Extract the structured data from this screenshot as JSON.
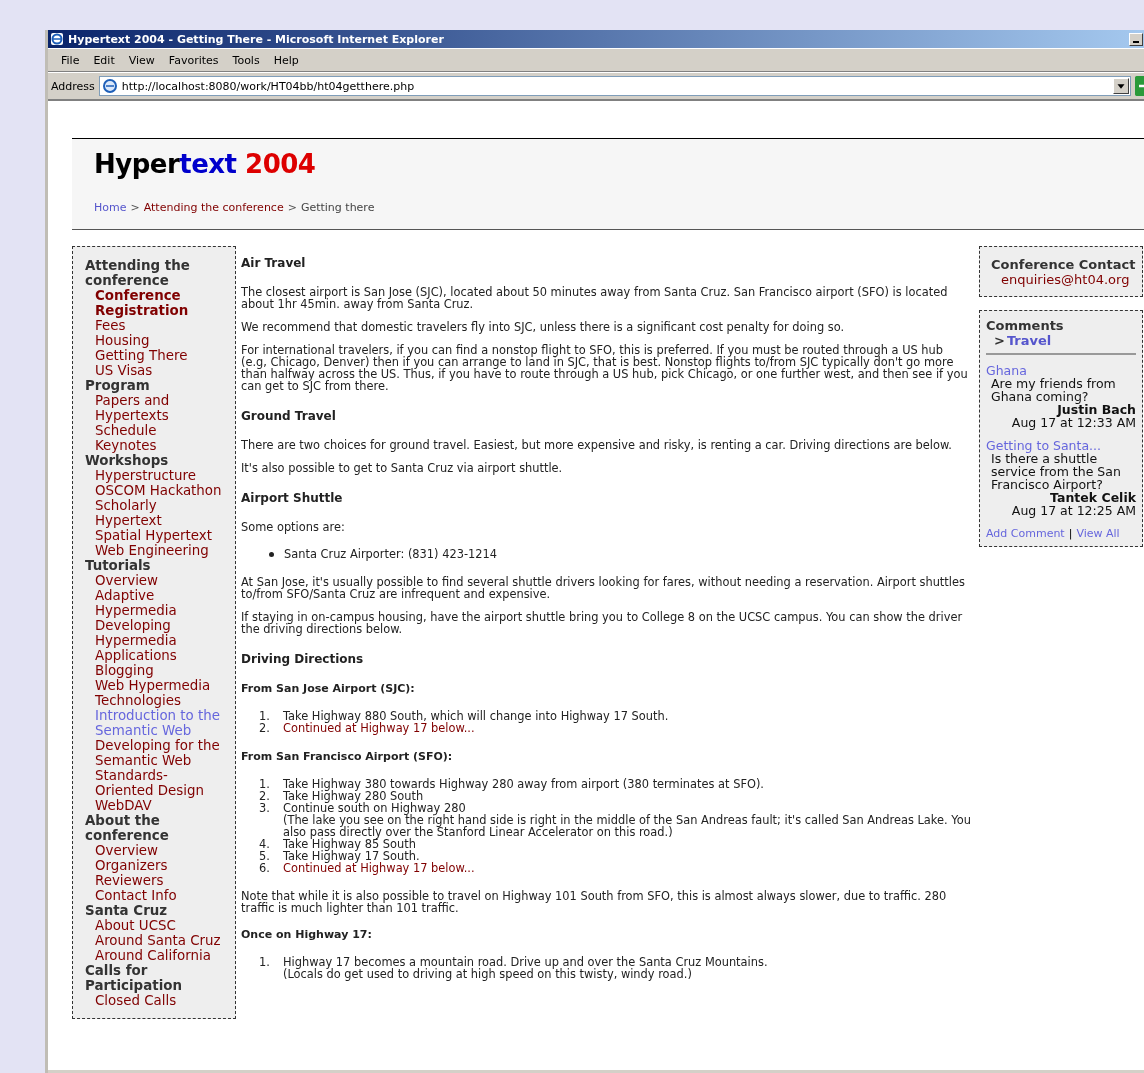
{
  "window": {
    "title": "Hypertext 2004 - Getting There - Microsoft Internet Explorer"
  },
  "menu": [
    "File",
    "Edit",
    "View",
    "Favorites",
    "Tools",
    "Help"
  ],
  "address": {
    "label": "Address",
    "url": "http://localhost:8080/work/HT04bb/ht04getthere.php"
  },
  "site_title": [
    {
      "text": "Hyper",
      "color": "#000000"
    },
    {
      "text": "text",
      "color": "#0000cc"
    },
    {
      "text": " 2004",
      "color": "#dd0000"
    }
  ],
  "breadcrumb": [
    {
      "text": "Home",
      "kind": "home"
    },
    {
      "text": ">",
      "kind": "sep"
    },
    {
      "text": "Attending the conference",
      "kind": "link"
    },
    {
      "text": ">",
      "kind": "sep"
    },
    {
      "text": "Getting there",
      "kind": "current"
    }
  ],
  "sidebar": [
    {
      "heading": "Attending the conference",
      "items": [
        {
          "text": "Conference Registration",
          "selected": true,
          "visited": false
        },
        {
          "text": "Fees",
          "selected": false,
          "visited": false
        },
        {
          "text": "Housing",
          "selected": false,
          "visited": false
        },
        {
          "text": "Getting There",
          "selected": false,
          "visited": false
        },
        {
          "text": "US Visas",
          "selected": false,
          "visited": false
        }
      ]
    },
    {
      "heading": "Program",
      "items": [
        {
          "text": "Papers and Hypertexts",
          "selected": false,
          "visited": false
        },
        {
          "text": "Schedule",
          "selected": false,
          "visited": false
        },
        {
          "text": "Keynotes",
          "selected": false,
          "visited": false
        }
      ]
    },
    {
      "heading": "Workshops",
      "items": [
        {
          "text": "Hyperstructure",
          "selected": false,
          "visited": false
        },
        {
          "text": "OSCOM Hackathon",
          "selected": false,
          "visited": false
        },
        {
          "text": "Scholarly Hypertext",
          "selected": false,
          "visited": false
        },
        {
          "text": "Spatial Hypertext",
          "selected": false,
          "visited": false
        },
        {
          "text": "Web Engineering",
          "selected": false,
          "visited": false
        }
      ]
    },
    {
      "heading": "Tutorials",
      "items": [
        {
          "text": "Overview",
          "selected": false,
          "visited": false
        },
        {
          "text": "Adaptive Hypermedia",
          "selected": false,
          "visited": false
        },
        {
          "text": "Developing Hypermedia Applications",
          "selected": false,
          "visited": false
        },
        {
          "text": "Blogging",
          "selected": false,
          "visited": false
        },
        {
          "text": "Web Hypermedia Technologies",
          "selected": false,
          "visited": false
        },
        {
          "text": "Introduction to the Semantic Web",
          "selected": false,
          "visited": true
        },
        {
          "text": "Developing for the Semantic Web",
          "selected": false,
          "visited": false
        },
        {
          "text": "Standards-Oriented Design",
          "selected": false,
          "visited": false
        },
        {
          "text": "WebDAV",
          "selected": false,
          "visited": false
        }
      ]
    },
    {
      "heading": "About the conference",
      "items": [
        {
          "text": "Overview",
          "selected": false,
          "visited": false
        },
        {
          "text": "Organizers",
          "selected": false,
          "visited": false
        },
        {
          "text": "Reviewers",
          "selected": false,
          "visited": false
        },
        {
          "text": "Contact Info",
          "selected": false,
          "visited": false
        }
      ]
    },
    {
      "heading": "Santa Cruz",
      "items": [
        {
          "text": "About UCSC",
          "selected": false,
          "visited": false
        },
        {
          "text": "Around Santa Cruz",
          "selected": false,
          "visited": false
        },
        {
          "text": "Around California",
          "selected": false,
          "visited": false
        }
      ]
    },
    {
      "heading": "Calls for Participation",
      "items": [
        {
          "text": "Closed Calls",
          "selected": false,
          "visited": false
        }
      ]
    }
  ],
  "article": [
    {
      "kind": "heading",
      "text": "Air Travel"
    },
    {
      "kind": "paragraph",
      "text": "The closest airport is San Jose (SJC), located about 50 minutes away from Santa Cruz. San Francisco airport (SFO) is located about 1hr 45min. away from Santa Cruz."
    },
    {
      "kind": "paragraph",
      "text": "We recommend that domestic travelers fly into SJC, unless there is a significant cost penalty for doing so."
    },
    {
      "kind": "paragraph",
      "text": "For international travelers, if you can find a nonstop flight to SFO, this is preferred. If you must be routed through a US hub (e.g, Chicago, Denver) then if you can arrange to land in SJC, that is best. Nonstop flights to/from SJC typically don't go more than halfway across the US. Thus, if you have to route through a US hub, pick Chicago, or one further west, and then see if you can get to SJC from there."
    },
    {
      "kind": "heading",
      "text": "Ground Travel"
    },
    {
      "kind": "paragraph",
      "text": "There are two choices for ground travel. Easiest, but more expensive and risky, is renting a car. Driving directions are below."
    },
    {
      "kind": "paragraph",
      "text": "It's also possible to get to Santa Cruz via airport shuttle."
    },
    {
      "kind": "heading",
      "text": "Airport Shuttle"
    },
    {
      "kind": "paragraph",
      "text": "Some options are:"
    },
    {
      "kind": "bullets",
      "items": [
        {
          "text": "Santa Cruz Airporter: (831) 423-1214",
          "kind": "text"
        }
      ]
    },
    {
      "kind": "paragraph",
      "text": "At San Jose, it's usually possible to find several shuttle drivers looking for fares, without needing a reservation. Airport shuttles to/from SFO/Santa Cruz are infrequent and expensive."
    },
    {
      "kind": "paragraph",
      "text": "If staying in on-campus housing, have the airport shuttle bring you to College 8 on the UCSC campus. You can show the driver the driving directions below."
    },
    {
      "kind": "heading",
      "text": "Driving Directions"
    },
    {
      "kind": "subheading",
      "text": "From San Jose Airport (SJC):"
    },
    {
      "kind": "numbered",
      "items": [
        {
          "number": "1.",
          "text": "Take Highway 880 South, which will change into Highway 17 South.",
          "kind": "text"
        },
        {
          "number": "2.",
          "text": "Continued at Highway 17 below...",
          "kind": "link"
        }
      ]
    },
    {
      "kind": "subheading",
      "text": "From San Francisco Airport (SFO):"
    },
    {
      "kind": "numbered",
      "items": [
        {
          "number": "1.",
          "text": "Take Highway 380 towards Highway 280 away from airport (380 terminates at SFO).",
          "kind": "text"
        },
        {
          "number": "2.",
          "text": "Take Highway 280 South",
          "kind": "text"
        },
        {
          "number": "3.",
          "text": "Continue south on Highway 280",
          "kind": "text",
          "note": "(The lake you see on the right hand side is right in the middle of the San Andreas fault; it's called San Andreas Lake. You also pass directly over the Stanford Linear Accelerator on this road.)"
        },
        {
          "number": "4.",
          "text": "Take Highway 85 South",
          "kind": "text"
        },
        {
          "number": "5.",
          "text": "Take Highway 17 South.",
          "kind": "text"
        },
        {
          "number": "6.",
          "text": "Continued at Highway 17 below...",
          "kind": "link"
        }
      ]
    },
    {
      "kind": "paragraph",
      "text": "Note that while it is also possible to travel on Highway 101 South from SFO, this is almost always slower, due to traffic. 280 traffic is much lighter than 101 traffic."
    },
    {
      "kind": "subheading",
      "text": "Once on Highway 17:"
    },
    {
      "kind": "numbered",
      "items": [
        {
          "number": "1.",
          "text": "Highway 17 becomes a mountain road. Drive up and over the Santa Cruz Mountains.",
          "kind": "text",
          "note": "(Locals do get used to driving at high speed on this twisty, windy road.)"
        }
      ]
    }
  ],
  "contact": {
    "title": "Conference Contact",
    "email": "enquiries@ht04.org"
  },
  "comments": {
    "title": "Comments",
    "topic_arrow": ">",
    "topic": "Travel",
    "items": [
      {
        "subject": "Ghana",
        "body": "Are my friends from Ghana coming?",
        "author": "Justin Bach",
        "date": "Aug 17 at 12:33 AM"
      },
      {
        "subject": "Getting to Santa...",
        "body": "Is there a shuttle service from the San Francisco Airport?",
        "author": "Tantek Celik",
        "date": "Aug 17 at 12:25 AM"
      }
    ],
    "links": [
      "Add Comment",
      "View All"
    ],
    "separator": "|"
  }
}
